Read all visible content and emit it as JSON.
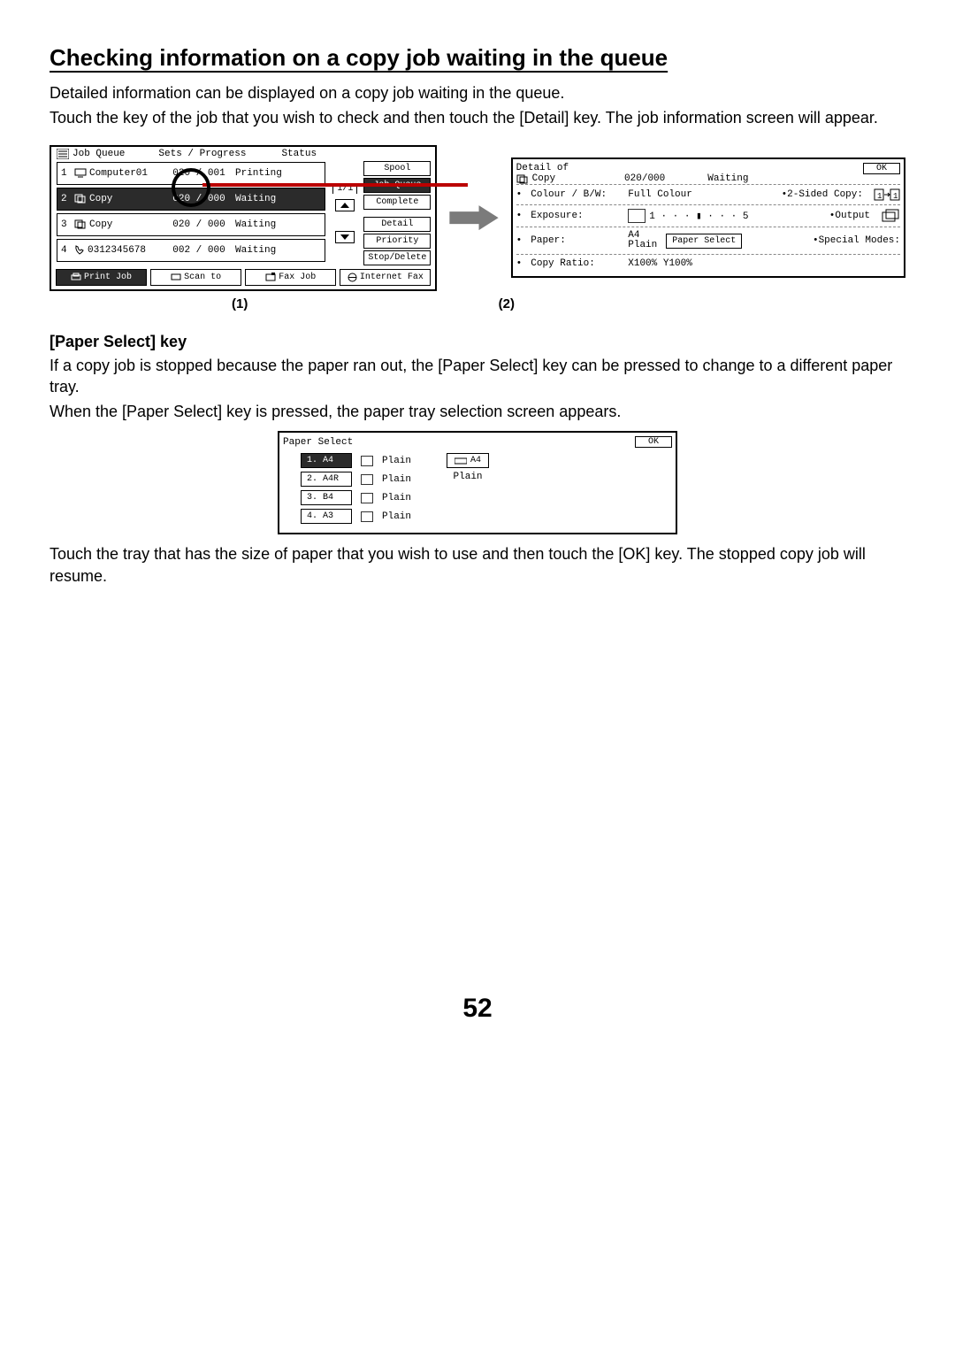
{
  "heading": "Checking information on a copy job waiting in the queue",
  "intro1": "Detailed information can be displayed on a copy job waiting in the queue.",
  "intro2": "Touch the key of the job that you wish to check and then touch the [Detail] key. The job information screen will appear.",
  "jobQueue": {
    "title": "Job Queue",
    "colSets": "Sets / Progress",
    "colStatus": "Status",
    "pageCount": "1/1",
    "rows": [
      {
        "num": "1",
        "name": "Computer01",
        "sets": "020 / 001",
        "status": "Printing",
        "selected": false,
        "icon": "pc"
      },
      {
        "num": "2",
        "name": "Copy",
        "sets": "020 / 000",
        "status": "Waiting",
        "selected": true,
        "icon": "copy"
      },
      {
        "num": "3",
        "name": "Copy",
        "sets": "020 / 000",
        "status": "Waiting",
        "selected": false,
        "icon": "copy"
      },
      {
        "num": "4",
        "name": "0312345678",
        "sets": "002 / 000",
        "status": "Waiting",
        "selected": false,
        "icon": "phone"
      }
    ],
    "side": {
      "spool": "Spool",
      "jobQueue": "Job Queue",
      "complete": "Complete",
      "detail": "Detail",
      "priority": "Priority",
      "stopDelete": "Stop/Delete"
    },
    "tabs": {
      "print": "Print Job",
      "scan": "Scan to",
      "fax": "Fax Job",
      "ifax": "Internet Fax"
    }
  },
  "callout1": "(1)",
  "callout2": "(2)",
  "detail": {
    "title": "Detail of",
    "jobName": "Copy",
    "count": "020/000",
    "state": "Waiting",
    "ok": "OK",
    "rows": {
      "colour_l": "Colour / B/W:",
      "colour_v": "Full Colour",
      "twosided_l": "2-Sided Copy:",
      "exposure_l": "Exposure:",
      "exposure_scale": "1 · · · ▮ · · · 5",
      "output_l": "Output",
      "paper_l": "Paper:",
      "paper_v1": "A4",
      "paper_v2": "Plain",
      "paper_btn": "Paper Select",
      "special_l": "Special Modes:",
      "ratio_l": "Copy Ratio:",
      "ratio_v": "X100%  Y100%"
    }
  },
  "paperSelectHeading": "[Paper Select] key",
  "psPara1": "If a copy job is stopped because the paper ran out, the [Paper Select] key can be pressed to change to a different paper tray.",
  "psPara2": "When the [Paper Select] key is pressed, the paper tray selection screen appears.",
  "paperSelect": {
    "title": "Paper Select",
    "ok": "OK",
    "trays": [
      {
        "label": "1. A4",
        "type": "Plain",
        "selected": true
      },
      {
        "label": "2. A4R",
        "type": "Plain",
        "selected": false
      },
      {
        "label": "3. B4",
        "type": "Plain",
        "selected": false
      },
      {
        "label": "4. A3",
        "type": "Plain",
        "selected": false
      }
    ],
    "bypass": {
      "size": "A4",
      "type": "Plain"
    }
  },
  "closing": "Touch the tray that has the size of paper that you wish to use and then touch the [OK] key. The stopped copy job will resume.",
  "pageNumber": "52"
}
